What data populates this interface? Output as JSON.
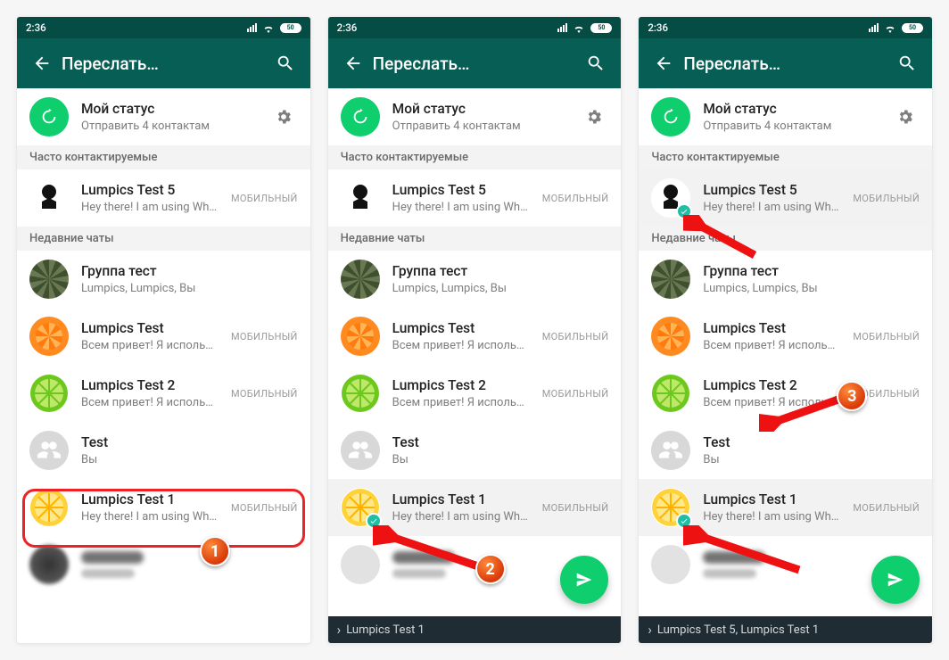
{
  "statusbar": {
    "time": "2:36",
    "battery_text": "50"
  },
  "header": {
    "title": "Переслать…"
  },
  "status_row": {
    "name": "Мой статус",
    "sub": "Отправить 4 контактам"
  },
  "sections": {
    "frequent": "Часто контактируемые",
    "recent": "Недавние чаты"
  },
  "frequent": [
    {
      "name": "Lumpics Test 5",
      "sub": "Hey there! I am using WhatsApp.",
      "badge": "МОБИЛЬНЫЙ"
    }
  ],
  "recent": [
    {
      "name": "Группа тест",
      "sub": "Lumpics, Lumpics, Вы",
      "badge": ""
    },
    {
      "name": "Lumpics Test",
      "sub": "Всем привет! Я использую WhatsApp.",
      "badge": "МОБИЛЬНЫЙ"
    },
    {
      "name": "Lumpics Test 2",
      "sub": "Всем привет! Я использую WhatsApp.",
      "badge": "МОБИЛЬНЫЙ"
    },
    {
      "name": "Test",
      "sub": "Вы",
      "badge": ""
    },
    {
      "name": "Lumpics Test 1",
      "sub": "Hey there! I am using WhatsApp.",
      "badge": "МОБИЛЬНЫЙ"
    }
  ],
  "bottom": {
    "screen2": "Lumpics Test 1",
    "screen3": "Lumpics Test 5, Lumpics Test 1"
  },
  "steps": {
    "1": "1",
    "2": "2",
    "3": "3"
  },
  "colors": {
    "brand": "#075e55",
    "accent": "#0fce6e",
    "check": "#1fbea5",
    "highlight": "#e22"
  }
}
